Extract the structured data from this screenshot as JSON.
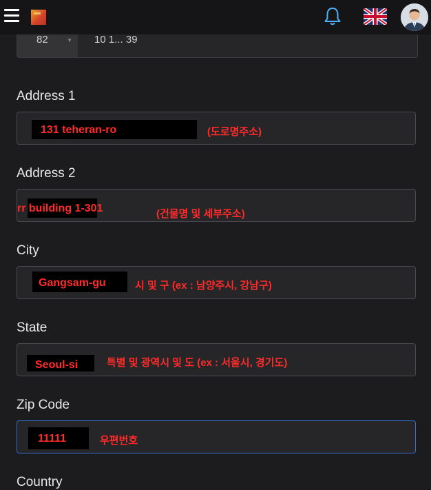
{
  "header": {
    "menu_icon": "hamburger-menu-icon",
    "logo_icon": "app-logo",
    "notification_icon": "bell-icon",
    "language_icon": "uk-flag-icon",
    "avatar_icon": "user-avatar"
  },
  "phone": {
    "code": "82",
    "number": "10 1... 39"
  },
  "form": {
    "address1": {
      "label": "Address 1",
      "value": "131 teheran-ro",
      "hint": "(도로명주소)"
    },
    "address2": {
      "label": "Address 2",
      "value": "rr building 1-301",
      "hint": "(건물명 및 세부주소)"
    },
    "city": {
      "label": "City",
      "value": "Gangsam-gu",
      "hint": "시 및 구 (ex : 남양주시, 강남구)"
    },
    "state": {
      "label": "State",
      "value": "Seoul-si",
      "hint": "특별 및 광역시 및 도 (ex : 서울시, 경기도)"
    },
    "zip": {
      "label": "Zip Code",
      "value": "11111",
      "hint": "우편번호"
    },
    "country": {
      "label": "Country"
    }
  },
  "colors": {
    "accent": "#2e6fd1",
    "annotation": "#ff2a2a",
    "background": "#1c1c1e"
  }
}
